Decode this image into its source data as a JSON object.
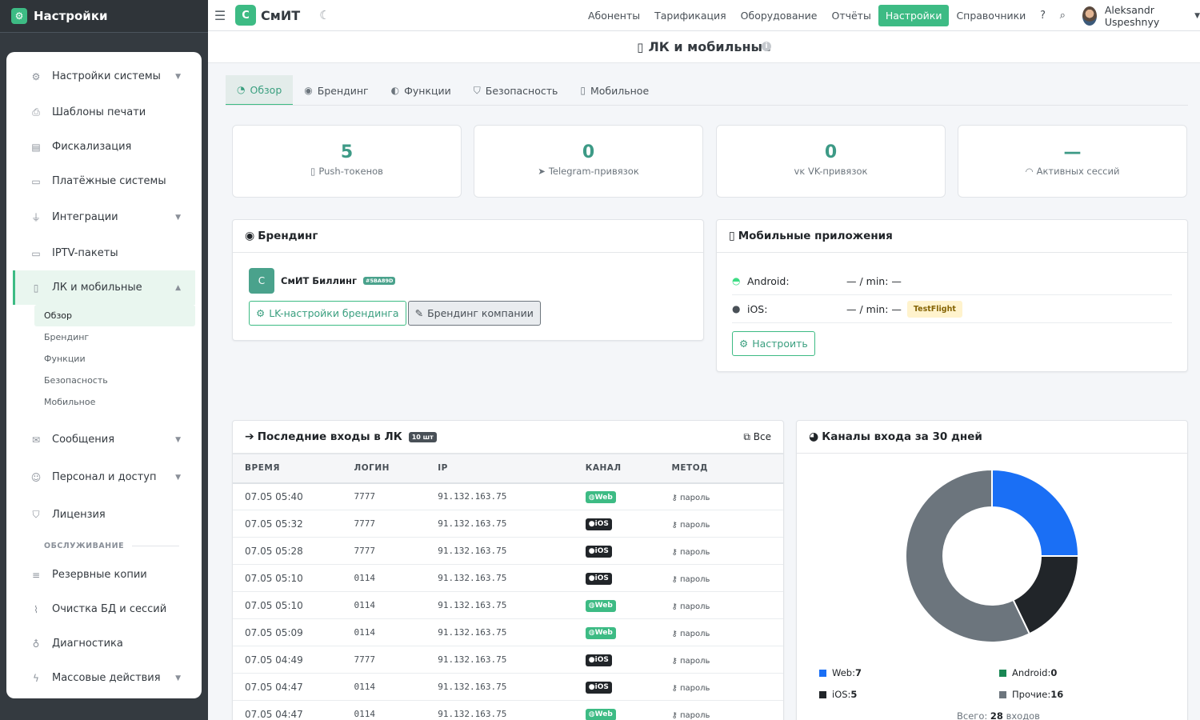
{
  "sidebar": {
    "brand": "Настройки",
    "items": [
      {
        "label": "Настройки системы",
        "icon": "gears-icon",
        "glyph": "⚙",
        "chev": true,
        "tall": true
      },
      {
        "label": "Шаблоны печати",
        "icon": "printer-icon",
        "glyph": "⎙",
        "chev": false
      },
      {
        "label": "Фискализация",
        "icon": "cash-register-icon",
        "glyph": "▤",
        "chev": false
      },
      {
        "label": "Платёжные системы",
        "icon": "credit-card-icon",
        "glyph": "▭",
        "chev": false
      },
      {
        "label": "Интеграции",
        "icon": "plug-icon",
        "glyph": "⏚",
        "chev": true,
        "tall": true
      },
      {
        "label": "IPTV-пакеты",
        "icon": "tv-icon",
        "glyph": "▭",
        "chev": false
      },
      {
        "label": "ЛК и мобильные",
        "icon": "mobile-icon",
        "glyph": "▯",
        "chev": true,
        "active": true
      }
    ],
    "subitems": [
      "Обзор",
      "Брендинг",
      "Функции",
      "Безопасность",
      "Мобильное"
    ],
    "items2": [
      {
        "label": "Сообщения",
        "icon": "envelope-icon",
        "glyph": "✉",
        "chev": true,
        "tall": true
      },
      {
        "label": "Персонал и доступ",
        "icon": "users-icon",
        "glyph": "☺",
        "chev": true,
        "tall": true
      },
      {
        "label": "Лицензия",
        "icon": "shield-icon",
        "glyph": "⛉",
        "chev": false,
        "tall": true
      }
    ],
    "section": "ОБСЛУЖИВАНИЕ",
    "items3": [
      {
        "label": "Резервные копии",
        "icon": "database-icon",
        "glyph": "≡",
        "chev": false
      },
      {
        "label": "Очистка БД и сессий",
        "icon": "broom-icon",
        "glyph": "⌇",
        "chev": false
      },
      {
        "label": "Диагностика",
        "icon": "stethoscope-icon",
        "glyph": "♁",
        "chev": false
      },
      {
        "label": "Массовые действия",
        "icon": "bolt-icon",
        "glyph": "ϟ",
        "chev": true
      }
    ]
  },
  "topbar": {
    "logo_letter": "С",
    "logo_text": "СмИТ",
    "nav": [
      "Абоненты",
      "Тарификация",
      "Оборудование",
      "Отчёты",
      "Настройки",
      "Справочники"
    ],
    "active_nav": 4,
    "user": "Aleksandr Uspeshnyy"
  },
  "page": {
    "title": "ЛК и мобильные"
  },
  "tabs": [
    {
      "label": "Обзор",
      "icon": "dashboard-icon",
      "glyph": "◔",
      "active": true
    },
    {
      "label": "Брендинг",
      "icon": "palette-icon",
      "glyph": "◉"
    },
    {
      "label": "Функции",
      "icon": "toggle-icon",
      "glyph": "◐"
    },
    {
      "label": "Безопасность",
      "icon": "shield-icon",
      "glyph": "⛉"
    },
    {
      "label": "Мобильное",
      "icon": "mobile-icon",
      "glyph": "▯"
    }
  ],
  "stats": [
    {
      "value": "5",
      "label": "Push-токенов",
      "icon": "mobile-icon",
      "glyph": "▯"
    },
    {
      "value": "0",
      "label": "Telegram-привязок",
      "icon": "telegram-icon",
      "glyph": "➤"
    },
    {
      "value": "0",
      "label": "VK-привязок",
      "icon": "vk-icon",
      "glyph": "ᴠᴋ"
    },
    {
      "value": "—",
      "label": "Активных сессий",
      "icon": "wifi-icon",
      "glyph": "◠"
    }
  ],
  "branding": {
    "title": "Брендинг",
    "logo_letter": "С",
    "name": "СмИТ Биллинг",
    "color_badge": "#5BA89D",
    "btn1": "LK-настройки брендинга",
    "btn2": "Брендинг компании"
  },
  "mobile": {
    "title": "Мобильные приложения",
    "android_label": "Android:",
    "android_value": "— / min: —",
    "ios_label": "iOS:",
    "ios_value": "— / min: —",
    "testflight": "TestFlight",
    "btn": "Настроить"
  },
  "logins": {
    "title": "Последние входы в ЛК",
    "count_badge": "10 шт",
    "all_link": "Все",
    "headers": [
      "ВРЕМЯ",
      "ЛОГИН",
      "IP",
      "КАНАЛ",
      "МЕТОД"
    ],
    "rows": [
      {
        "time": "07.05 05:40",
        "login": "7777",
        "ip": "91.132.163.75",
        "channel": "Web",
        "method": "пароль"
      },
      {
        "time": "07.05 05:32",
        "login": "7777",
        "ip": "91.132.163.75",
        "channel": "iOS",
        "method": "пароль"
      },
      {
        "time": "07.05 05:28",
        "login": "7777",
        "ip": "91.132.163.75",
        "channel": "iOS",
        "method": "пароль"
      },
      {
        "time": "07.05 05:10",
        "login": "0114",
        "ip": "91.132.163.75",
        "channel": "iOS",
        "method": "пароль"
      },
      {
        "time": "07.05 05:10",
        "login": "0114",
        "ip": "91.132.163.75",
        "channel": "Web",
        "method": "пароль"
      },
      {
        "time": "07.05 05:09",
        "login": "0114",
        "ip": "91.132.163.75",
        "channel": "Web",
        "method": "пароль"
      },
      {
        "time": "07.05 04:49",
        "login": "7777",
        "ip": "91.132.163.75",
        "channel": "iOS",
        "method": "пароль"
      },
      {
        "time": "07.05 04:47",
        "login": "0114",
        "ip": "91.132.163.75",
        "channel": "iOS",
        "method": "пароль"
      },
      {
        "time": "07.05 04:47",
        "login": "0114",
        "ip": "91.132.163.75",
        "channel": "Web",
        "method": "пароль"
      }
    ]
  },
  "chart_data": {
    "type": "pie",
    "title": "Каналы входа за 30 дней",
    "categories": [
      "Web",
      "Android",
      "iOS",
      "Прочие"
    ],
    "values": [
      7,
      0,
      5,
      16
    ],
    "colors": [
      "#1a6ff5",
      "#198754",
      "#212529",
      "#6c757d"
    ],
    "total_label": "Всего:",
    "total_value": "28",
    "total_suffix": "входов"
  }
}
